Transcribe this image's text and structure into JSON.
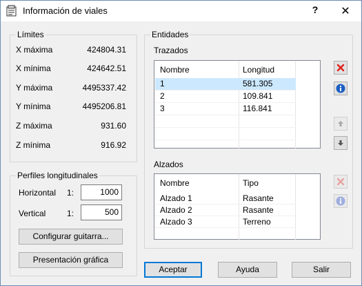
{
  "window": {
    "title": "Información de viales",
    "help_glyph": "?",
    "close_glyph": "✕"
  },
  "limites": {
    "legend": "Límites",
    "rows": [
      {
        "label": "X máxima",
        "value": "424804.31"
      },
      {
        "label": "X mínima",
        "value": "424642.51"
      },
      {
        "label": "Y máxima",
        "value": "4495337.42"
      },
      {
        "label": "Y mínima",
        "value": "4495206.81"
      },
      {
        "label": "Z máxima",
        "value": "931.60"
      },
      {
        "label": "Z mínima",
        "value": "916.92"
      }
    ]
  },
  "perfiles": {
    "legend": "Perfiles longitudinales",
    "horizontal_label": "Horizontal",
    "horizontal_prefix": "1:",
    "horizontal_value": "1000",
    "vertical_label": "Vertical",
    "vertical_prefix": "1:",
    "vertical_value": "500",
    "configurar_label": "Configurar guitarra...",
    "presentacion_label": "Presentación gráfica"
  },
  "entidades": {
    "legend": "Entidades",
    "trazados": {
      "label": "Trazados",
      "columns": [
        "Nombre",
        "Longitud"
      ],
      "rows": [
        {
          "nombre": "1",
          "longitud": "581.305",
          "selected": true
        },
        {
          "nombre": "2",
          "longitud": "109.841",
          "selected": false
        },
        {
          "nombre": "3",
          "longitud": "116.841",
          "selected": false
        }
      ]
    },
    "alzados": {
      "label": "Alzados",
      "columns": [
        "Nombre",
        "Tipo"
      ],
      "rows": [
        {
          "nombre": "Alzado 1",
          "tipo": "Rasante"
        },
        {
          "nombre": "Alzado 2",
          "tipo": "Rasante"
        },
        {
          "nombre": "Alzado 3",
          "tipo": "Terreno"
        }
      ]
    }
  },
  "footer": {
    "aceptar": "Aceptar",
    "ayuda": "Ayuda",
    "salir": "Salir"
  },
  "colors": {
    "accent": "#0078d7",
    "delete_red": "#e0201b",
    "info_blue": "#1c5fc2",
    "selection": "#cce8ff"
  }
}
